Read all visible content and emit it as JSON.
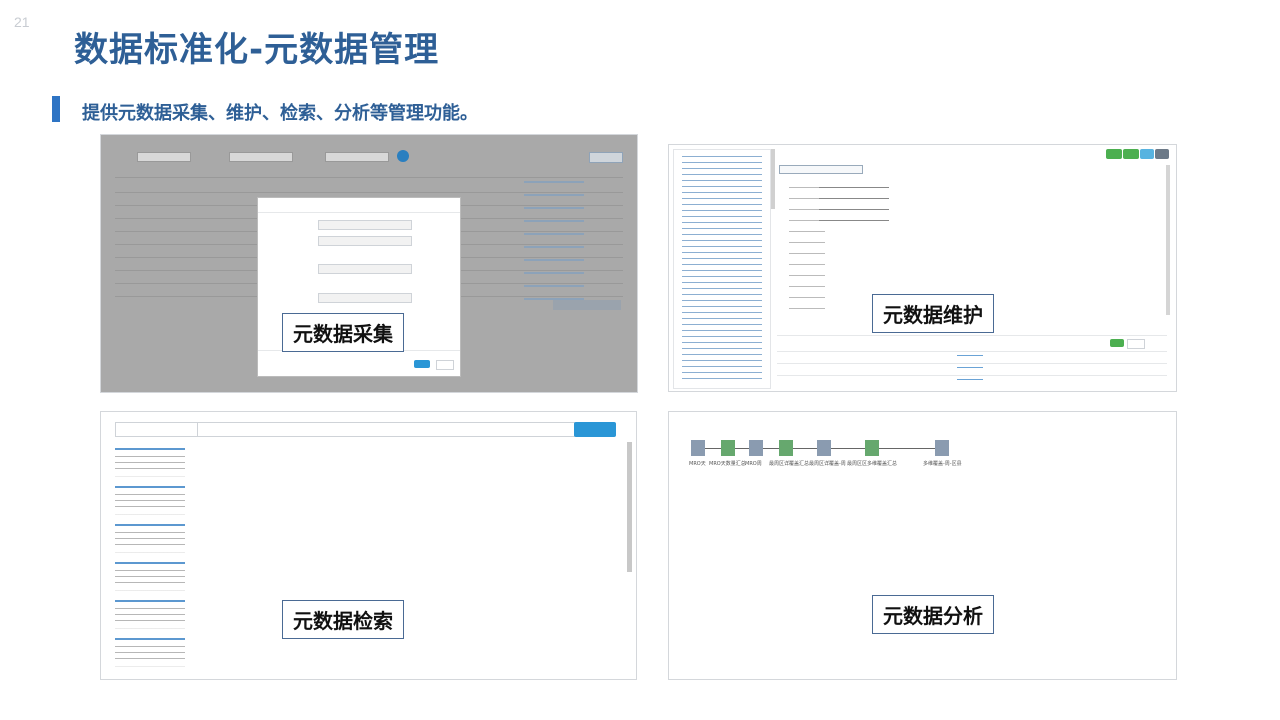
{
  "page_number": "21",
  "title": "数据标准化-元数据管理",
  "subtitle": "提供元数据采集、维护、检索、分析等管理功能。",
  "panels": {
    "collect": {
      "label": "元数据采集"
    },
    "maintain": {
      "label": "元数据维护"
    },
    "search": {
      "label": "元数据检索"
    },
    "analyze": {
      "label": "元数据分析",
      "nodes": [
        "MRO天",
        "MRO天数量汇总",
        "MRO周",
        "最周区详覆盖汇总",
        "最周区详覆盖-周",
        "最周区区多维覆盖汇总",
        "多维覆盖-周-区县"
      ]
    }
  },
  "colors": {
    "title": "#2e5f96",
    "accent_bar": "#2e74c4",
    "link": "#3f86c8",
    "button": "#2a96d6",
    "green": "#4caf50"
  }
}
